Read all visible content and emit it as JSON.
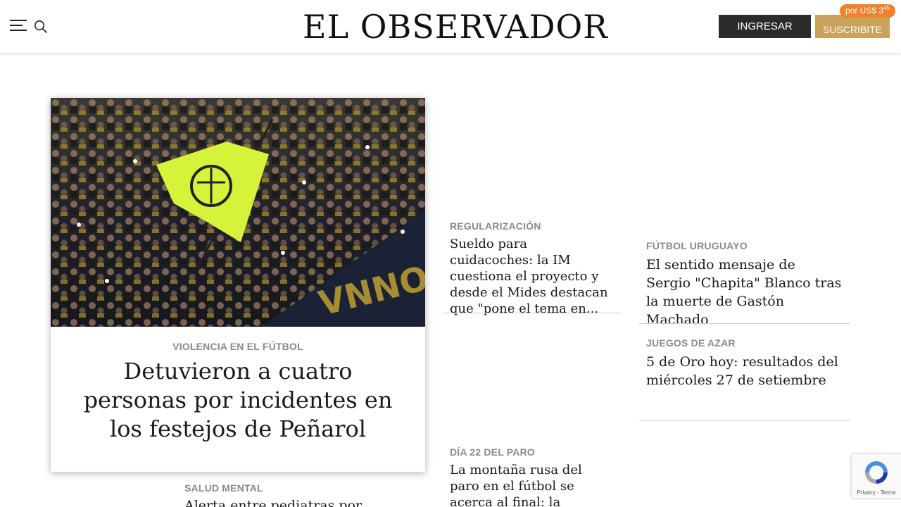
{
  "header": {
    "logo": "EL OBSERVADOR",
    "login_label": "INGRESAR",
    "subscribe_label": "SUSCRIBITE",
    "price_prefix": "por US$ 3",
    "price_cents": "45"
  },
  "main_story": {
    "kicker": "VIOLENCIA EN EL FÚTBOL",
    "title": "Detuvieron a cuatro personas por incidentes en los festejos de Peñarol"
  },
  "stories": [
    {
      "kicker": "REGULARIZACIÓN",
      "title": "Sueldo para cuidacoches: la IM cuestiona el proyecto y desde el Mides destacan que \"pone el tema en..."
    },
    {
      "kicker": "DÍA 22 DEL PARO",
      "title": "La montaña rusa del paro en el fútbol se acerca al final: la historia de lo que"
    },
    {
      "kicker": "FÚTBOL URUGUAYO",
      "title": "El sentido mensaje de Sergio \"Chapita\" Blanco tras la muerte de Gastón Machado"
    },
    {
      "kicker": "JUEGOS DE AZAR",
      "title": "5 de Oro hoy: resultados del miércoles 27 de setiembre"
    },
    {
      "kicker": "SALUD MENTAL",
      "title": "Alerta entre pediatras por aumento"
    }
  ],
  "recaptcha": {
    "label": "Privacy - Terms"
  },
  "colors": {
    "login_bg": "#2b2b2b",
    "subscribe_bg": "#c9a25c",
    "badge_bg": "#f47f29",
    "kicker": "#8a8a8a"
  }
}
